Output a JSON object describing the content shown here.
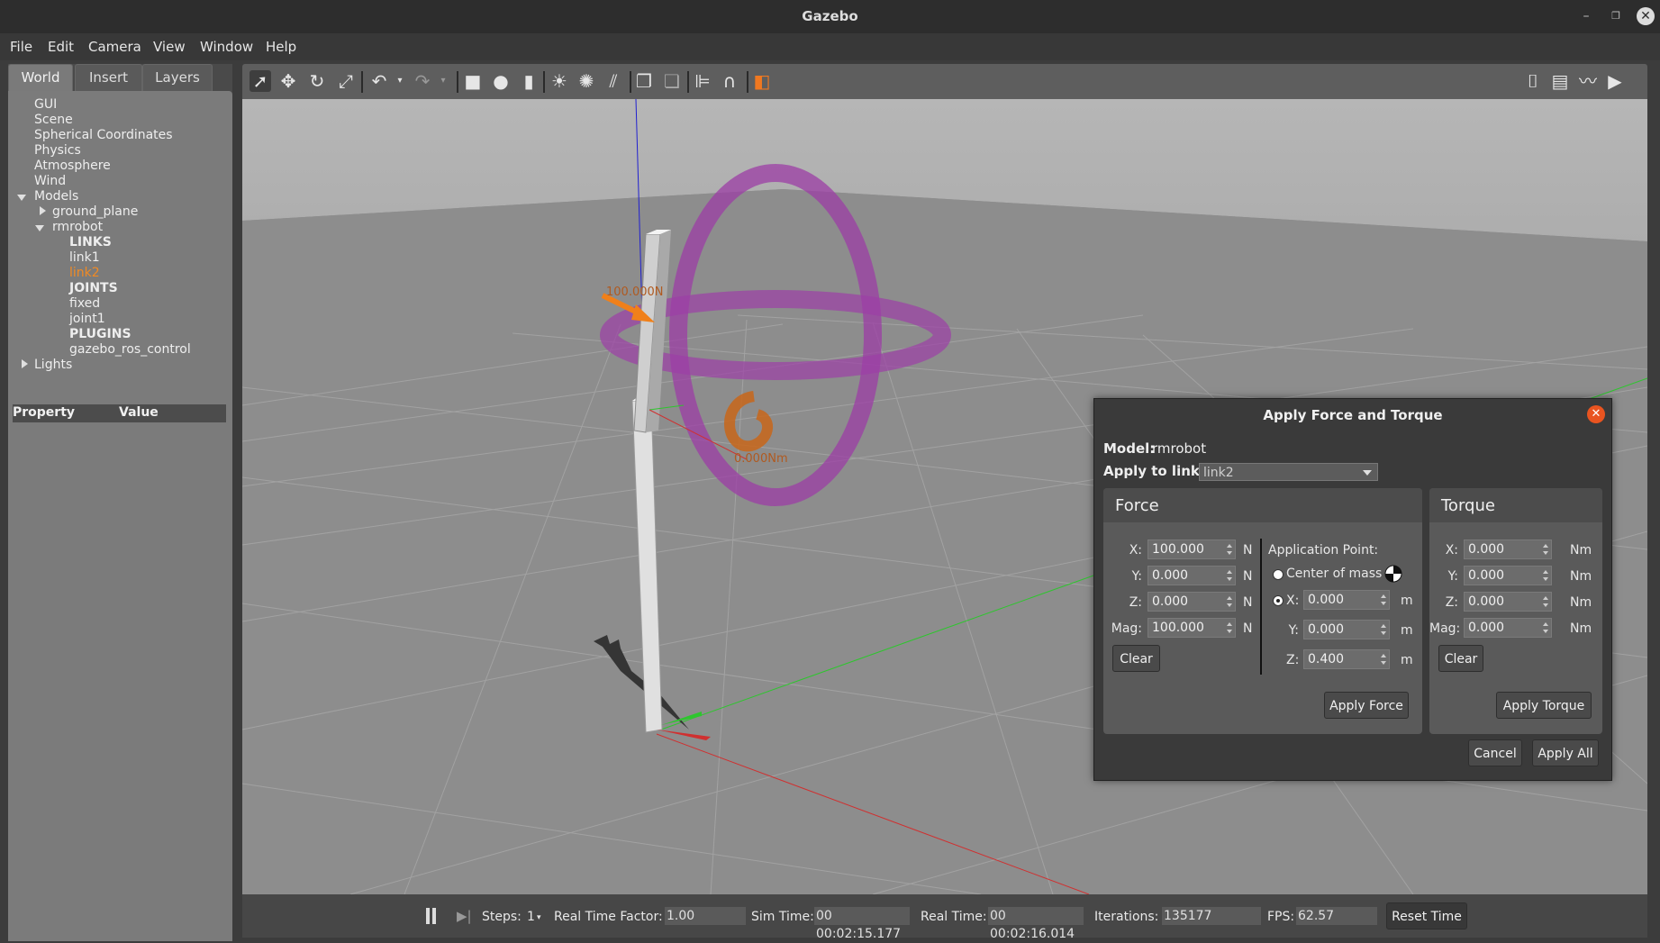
{
  "window": {
    "title": "Gazebo"
  },
  "menu": [
    "File",
    "Edit",
    "Camera",
    "View",
    "Window",
    "Help"
  ],
  "left_panel": {
    "tabs": [
      "World",
      "Insert",
      "Layers"
    ],
    "tree": {
      "gui": "GUI",
      "scene": "Scene",
      "spherical": "Spherical Coordinates",
      "physics": "Physics",
      "atmosphere": "Atmosphere",
      "wind": "Wind",
      "models": "Models",
      "ground_plane": "ground_plane",
      "rmrobot": "rmrobot",
      "links": "LINKS",
      "link1": "link1",
      "link2": "link2",
      "joints": "JOINTS",
      "fixed": "fixed",
      "joint1": "joint1",
      "plugins": "PLUGINS",
      "plugin1": "gazebo_ros_control",
      "lights": "Lights"
    },
    "property_header": {
      "property": "Property",
      "value": "Value"
    }
  },
  "toolbar_icons": [
    "select-icon",
    "translate-icon",
    "rotate-icon",
    "scale-icon",
    "undo-icon",
    "redo-icon",
    "box-icon",
    "sphere-icon",
    "cylinder-icon",
    "point-light-icon",
    "spot-light-icon",
    "directional-light-icon",
    "copy-icon",
    "paste-icon",
    "align-icon",
    "snap-icon",
    "view-angle-icon",
    "screenshot-icon",
    "log-icon",
    "plot-icon",
    "video-icon"
  ],
  "viewport": {
    "force_label": "100.000N",
    "torque_label": "0.000Nm",
    "colors": {
      "ring": "#9b3fa0",
      "arrow": "#f0801a",
      "ground": "#8c8c8c",
      "sky": "#b4b4b4"
    }
  },
  "dialog": {
    "title": "Apply Force and Torque",
    "model_label": "Model:",
    "model_value": "rmrobot",
    "link_label": "Apply to link:",
    "link_value": "link2",
    "force": {
      "title": "Force",
      "x_label": "X:",
      "x": "100.000",
      "y_label": "Y:",
      "y": "0.000",
      "z_label": "Z:",
      "z": "0.000",
      "mag_label": "Mag:",
      "mag": "100.000",
      "unit": "N",
      "clear": "Clear",
      "apply": "Apply Force",
      "app_point_label": "Application Point:",
      "com_label": "Center of mass",
      "px_label": "X:",
      "px": "0.000",
      "py_label": "Y:",
      "py": "0.000",
      "pz_label": "Z:",
      "pz": "0.400",
      "point_unit": "m"
    },
    "torque": {
      "title": "Torque",
      "x_label": "X:",
      "x": "0.000",
      "y_label": "Y:",
      "y": "0.000",
      "z_label": "Z:",
      "z": "0.000",
      "mag_label": "Mag:",
      "mag": "0.000",
      "unit": "Nm",
      "clear": "Clear",
      "apply": "Apply Torque"
    },
    "cancel": "Cancel",
    "apply_all": "Apply All"
  },
  "status": {
    "steps_label": "Steps:",
    "steps": "1",
    "rtf_label": "Real Time Factor:",
    "rtf": "1.00",
    "sim_label": "Sim Time:",
    "sim": "00 00:02:15.177",
    "real_label": "Real Time:",
    "real": "00 00:02:16.014",
    "iter_label": "Iterations:",
    "iter": "135177",
    "fps_label": "FPS:",
    "fps": "62.57",
    "reset": "Reset Time"
  }
}
